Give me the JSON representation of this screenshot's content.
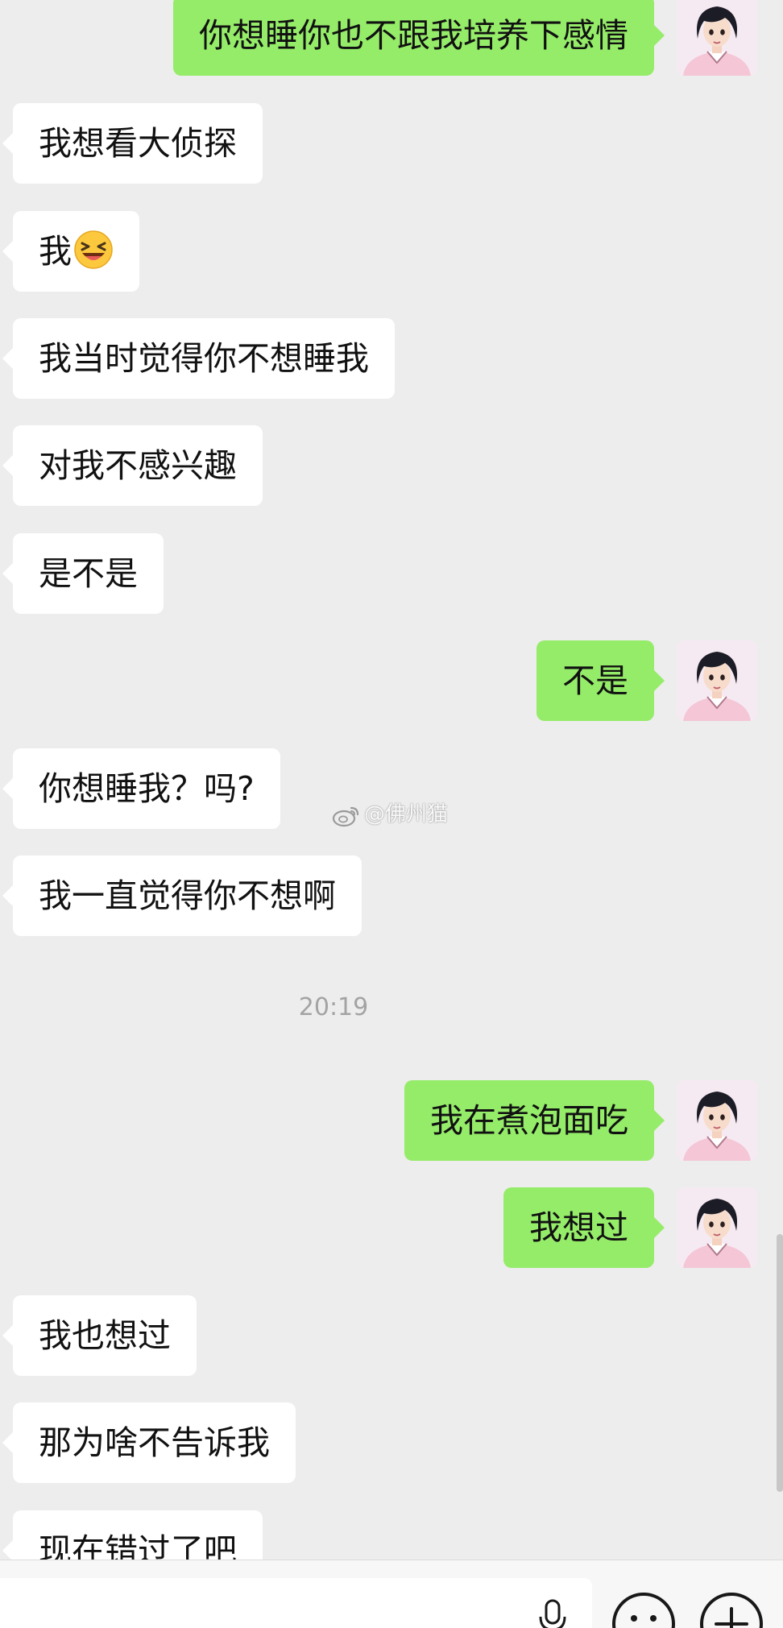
{
  "conversation": {
    "messages": [
      {
        "side": "out",
        "text": "你想睡你也不跟我培养下感情"
      },
      {
        "side": "in",
        "text": "我想看大侦探"
      },
      {
        "side": "in",
        "text": "我",
        "emoji": "laughing-face-emoji"
      },
      {
        "side": "in",
        "text": "我当时觉得你不想睡我"
      },
      {
        "side": "in",
        "text": "对我不感兴趣"
      },
      {
        "side": "in",
        "text": "是不是"
      },
      {
        "side": "out",
        "text": "不是"
      },
      {
        "side": "in",
        "text": "你想睡我？吗?"
      },
      {
        "side": "in",
        "text": "我一直觉得你不想啊"
      },
      {
        "side": "out",
        "text": "我在煮泡面吃"
      },
      {
        "side": "out",
        "text": "我想过"
      },
      {
        "side": "in",
        "text": "我也想过"
      },
      {
        "side": "in",
        "text": "那为啥不告诉我"
      },
      {
        "side": "in",
        "text": "现在错过了吧"
      }
    ],
    "timestamp": "20:19"
  },
  "watermark": "@佛州猫",
  "input_bar": {
    "icons": [
      "microphone-icon",
      "emoji-icon",
      "plus-icon"
    ]
  },
  "colors": {
    "background": "#ededed",
    "incoming_bubble": "#ffffff",
    "outgoing_bubble": "#95ec69",
    "timestamp": "#a3a3a3"
  }
}
